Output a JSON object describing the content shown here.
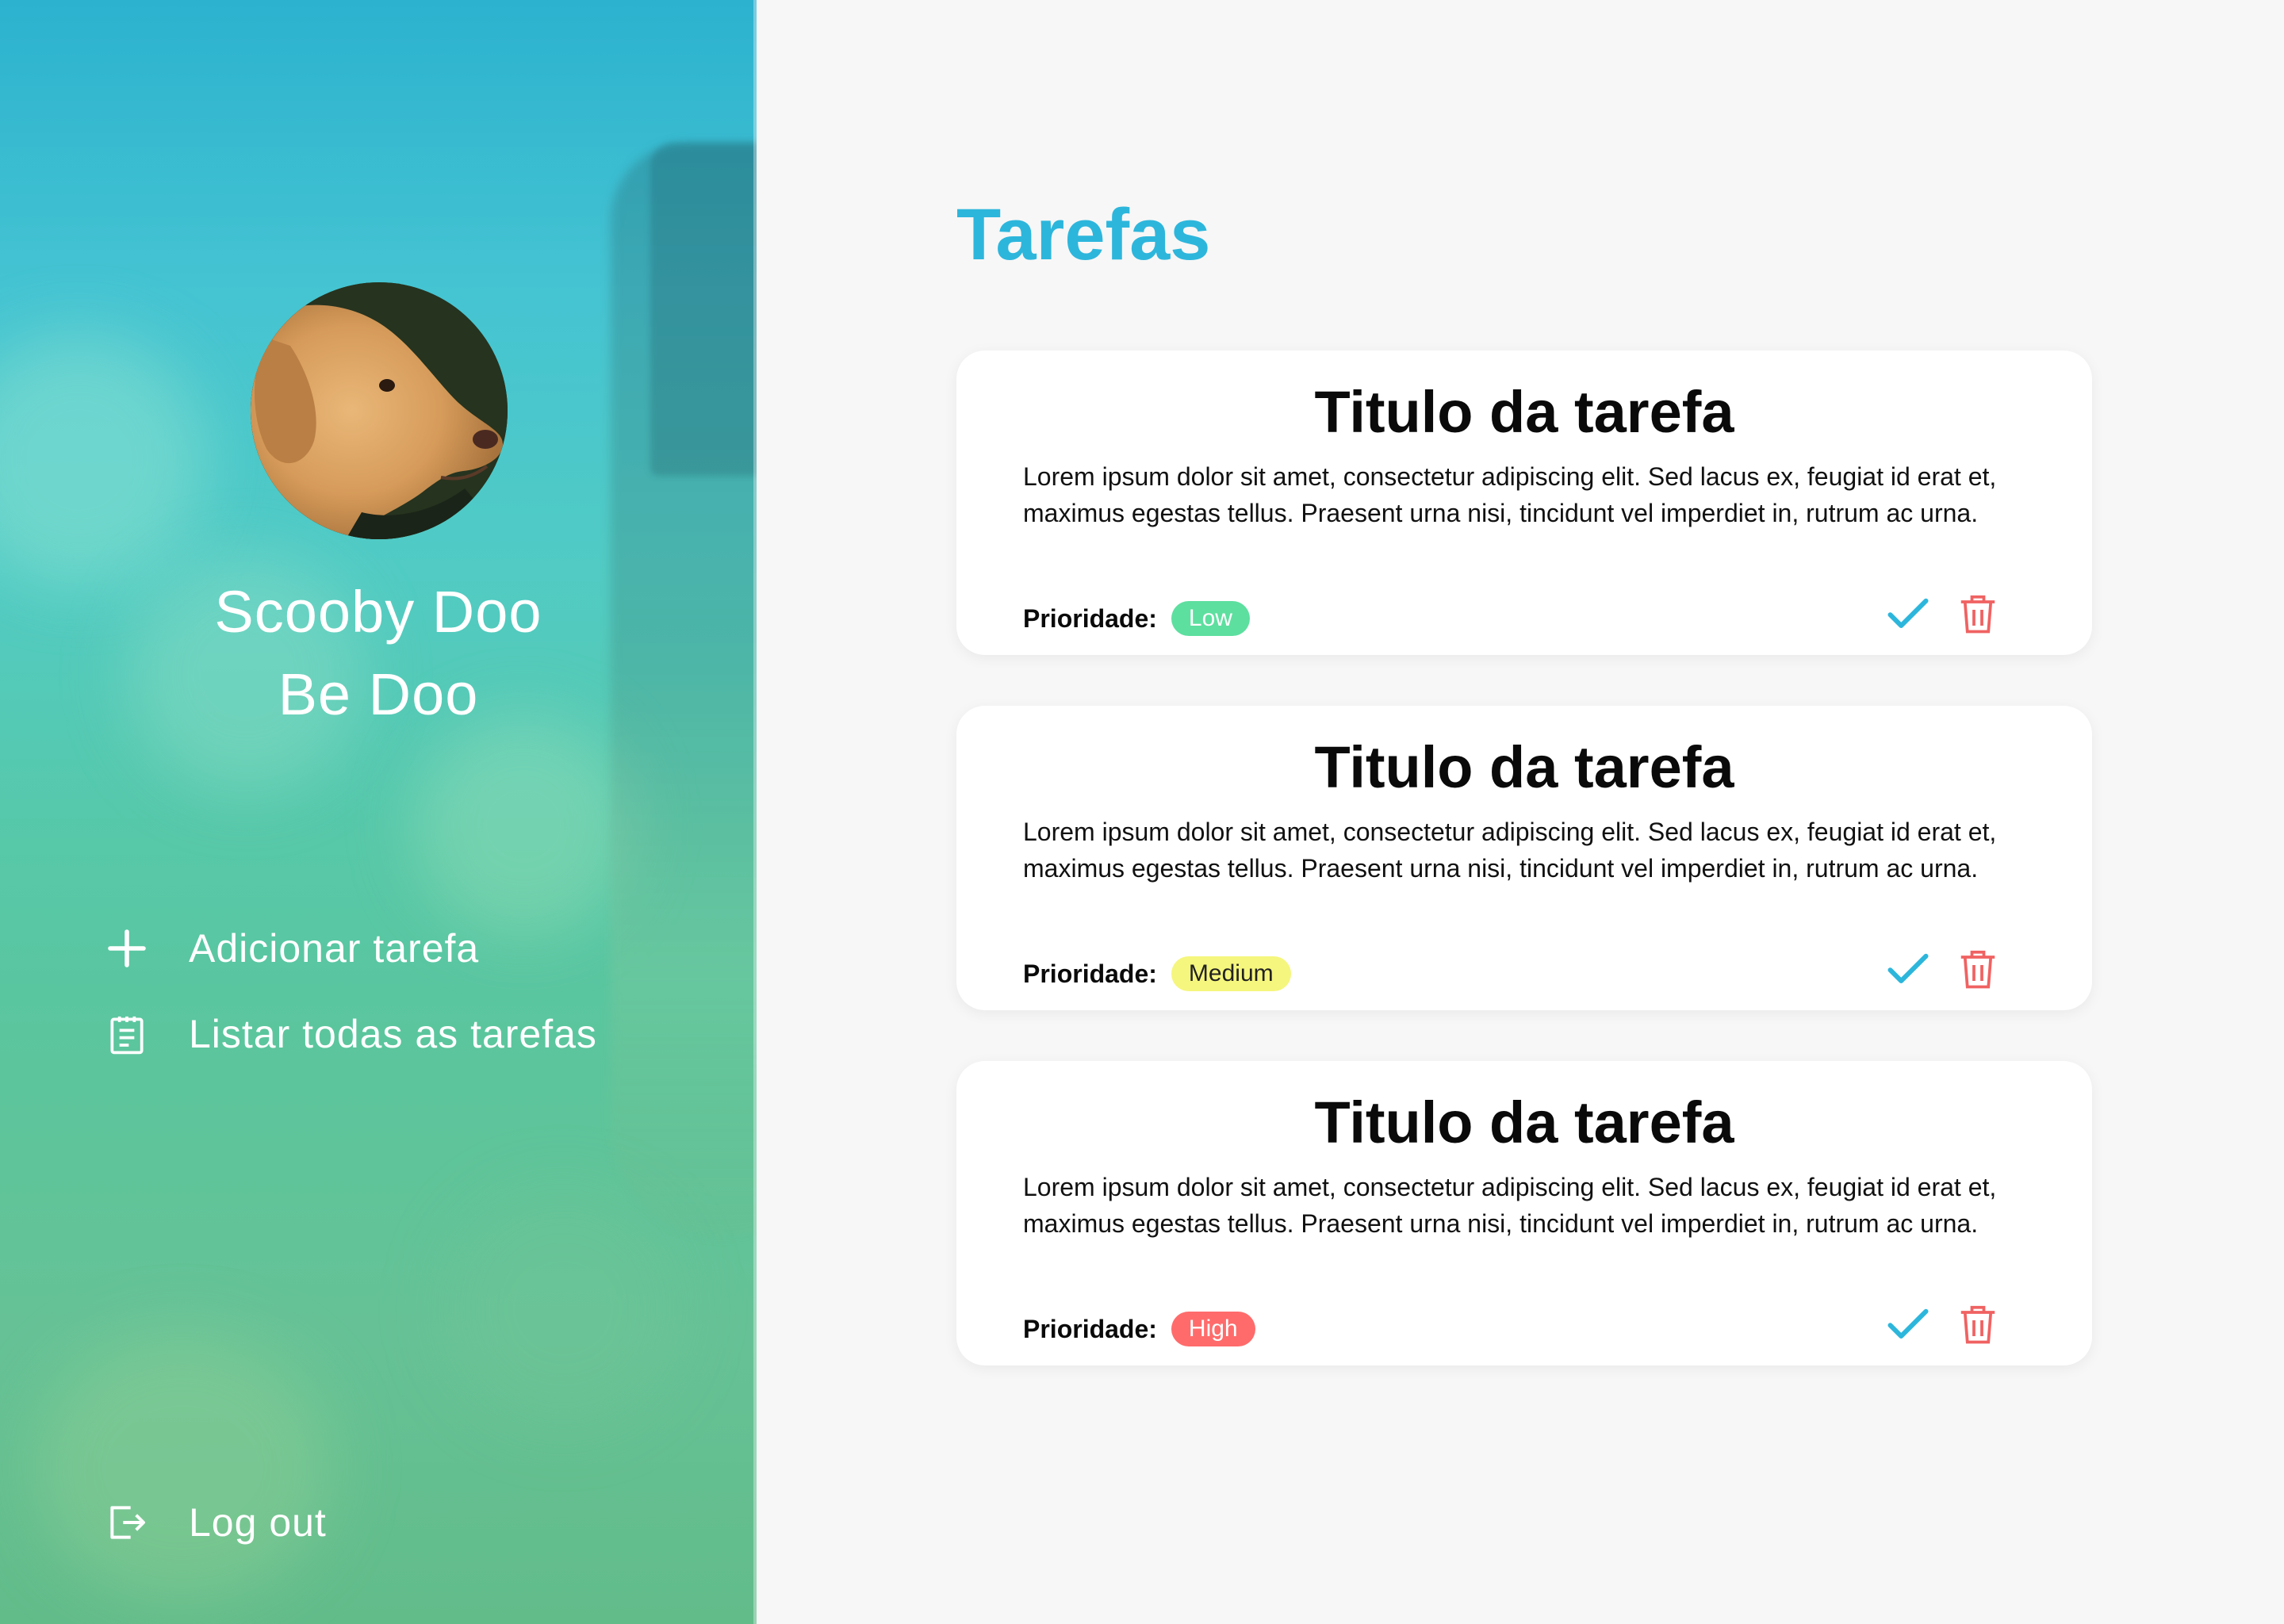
{
  "user": {
    "name_line1": "Scooby Doo",
    "name_line2": "Be Doo"
  },
  "sidebar": {
    "nav": [
      {
        "label": "Adicionar tarefa",
        "icon": "plus-icon"
      },
      {
        "label": "Listar todas as tarefas",
        "icon": "clipboard-icon"
      }
    ],
    "logout_label": "Log out",
    "logout_icon": "logout-icon"
  },
  "main": {
    "title": "Tarefas",
    "tasks": [
      {
        "title": "Titulo da tarefa",
        "description": "Lorem ipsum dolor sit amet, consectetur adipiscing elit. Sed lacus ex, feugiat id erat et, maximus egestas tellus. Praesent urna nisi, tincidunt vel imperdiet in, rutrum ac urna.",
        "priority_label": "Prioridade:",
        "priority": "Low"
      },
      {
        "title": "Titulo da tarefa",
        "description": "Lorem ipsum dolor sit amet, consectetur adipiscing elit. Sed lacus ex, feugiat id erat et, maximus egestas tellus. Praesent urna nisi, tincidunt vel imperdiet in, rutrum ac urna.",
        "priority_label": "Prioridade:",
        "priority": "Medium"
      },
      {
        "title": "Titulo da tarefa",
        "description": "Lorem ipsum dolor sit amet, consectetur adipiscing elit. Sed lacus ex, feugiat id erat et, maximus egestas tellus. Praesent urna nisi, tincidunt vel imperdiet in, rutrum ac urna.",
        "priority_label": "Prioridade:",
        "priority": "High"
      }
    ]
  },
  "colors": {
    "accent": "#2db6dc",
    "low": "#5ddf9f",
    "medium": "#f5f67d",
    "high": "#ff6b6b",
    "delete": "#f06262"
  }
}
